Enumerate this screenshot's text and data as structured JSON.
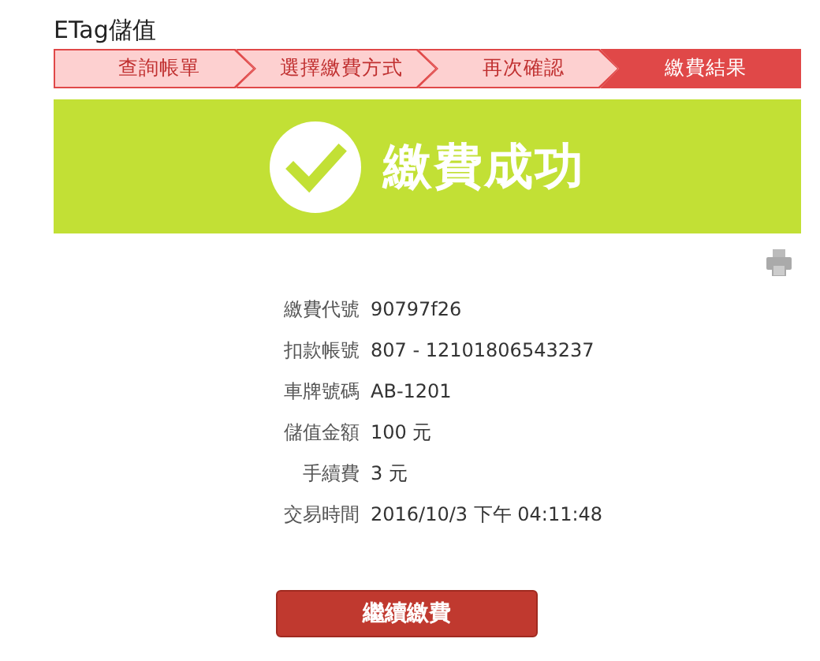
{
  "title": "ETag儲值",
  "steps": [
    {
      "label": "查詢帳單",
      "selected": false
    },
    {
      "label": "選擇繳費方式",
      "selected": false
    },
    {
      "label": "再次確認",
      "selected": false
    },
    {
      "label": "繳費結果",
      "selected": true
    }
  ],
  "banner": {
    "message": "繳費成功"
  },
  "details": [
    {
      "label": "繳費代號",
      "value": "90797f26"
    },
    {
      "label": "扣款帳號",
      "value": "807 - 12101806543237"
    },
    {
      "label": "車牌號碼",
      "value": "AB-1201"
    },
    {
      "label": "儲值金額",
      "value": "100 元"
    },
    {
      "label": "手續費",
      "value": "3 元"
    },
    {
      "label": "交易時間",
      "value": "2016/10/3 下午 04:11:48"
    }
  ],
  "button": {
    "label": "繼續繳費"
  }
}
